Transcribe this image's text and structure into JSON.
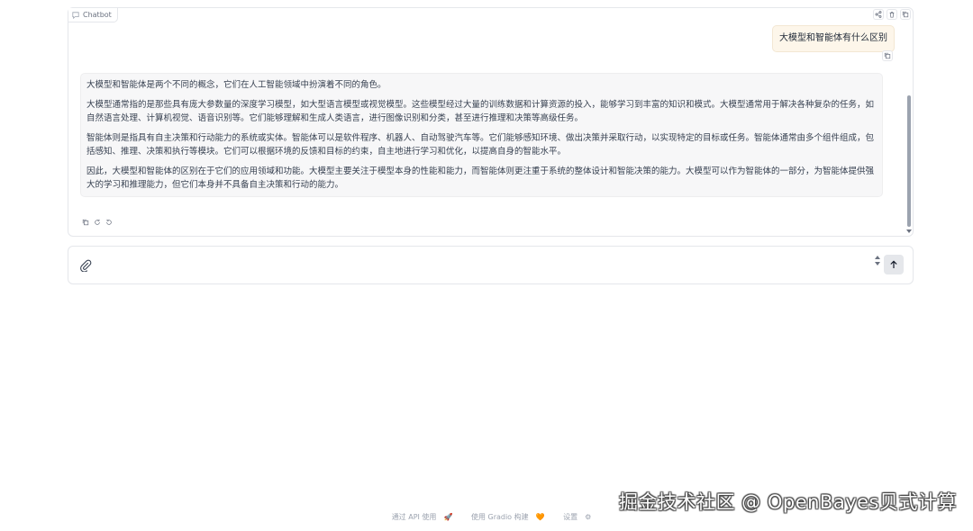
{
  "chatbot": {
    "label": "Chatbot",
    "user_message": "大模型和智能体有什么区别",
    "bot_paragraphs": [
      "大模型和智能体是两个不同的概念，它们在人工智能领域中扮演着不同的角色。",
      "大模型通常指的是那些具有庞大参数量的深度学习模型，如大型语言模型或视觉模型。这些模型经过大量的训练数据和计算资源的投入，能够学习到丰富的知识和模式。大模型通常用于解决各种复杂的任务，如自然语言处理、计算机视觉、语音识别等。它们能够理解和生成人类语言，进行图像识别和分类，甚至进行推理和决策等高级任务。",
      "智能体则是指具有自主决策和行动能力的系统或实体。智能体可以是软件程序、机器人、自动驾驶汽车等。它们能够感知环境、做出决策并采取行动，以实现特定的目标或任务。智能体通常由多个组件组成，包括感知、推理、决策和执行等模块。它们可以根据环境的反馈和目标的约束，自主地进行学习和优化，以提高自身的智能水平。",
      "因此，大模型和智能体的区别在于它们的应用领域和功能。大模型主要关注于模型本身的性能和能力，而智能体则更注重于系统的整体设计和智能决策的能力。大模型可以作为智能体的一部分，为智能体提供强大的学习和推理能力，但它们本身并不具备自主决策和行动的能力。"
    ]
  },
  "input": {
    "placeholder": "",
    "value": ""
  },
  "footer": {
    "api": "通过 API 使用",
    "api_icon": "🚀",
    "gradio": "使用 Gradio 构建",
    "gradio_icon": "🧡",
    "settings": "设置",
    "settings_icon": "⚙"
  },
  "watermark": "掘金技术社区 @ OpenBayes贝式计算"
}
